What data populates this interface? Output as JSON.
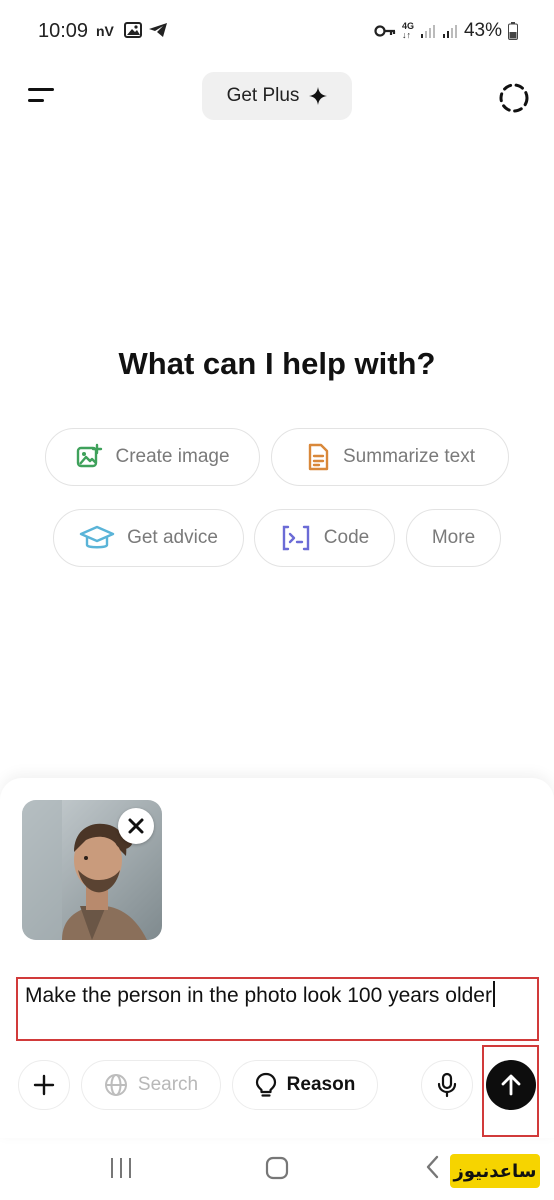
{
  "status": {
    "time": "10:09",
    "network": "4G",
    "battery": "43%"
  },
  "header": {
    "get_plus_label": "Get Plus"
  },
  "main": {
    "headline": "What can I help with?",
    "chips": [
      {
        "label": "Create image",
        "icon": "image-plus-icon",
        "color": "#3fa15b"
      },
      {
        "label": "Summarize text",
        "icon": "document-icon",
        "color": "#d9883a"
      },
      {
        "label": "Get advice",
        "icon": "graduation-cap-icon",
        "color": "#5ab4d8"
      },
      {
        "label": "Code",
        "icon": "code-icon",
        "color": "#6b6bd6"
      },
      {
        "label": "More"
      }
    ]
  },
  "composer": {
    "prompt_text": "Make the person in the photo look 100 years older",
    "tools": {
      "search_label": "Search",
      "reason_label": "Reason"
    }
  },
  "watermark": {
    "text": "ساعدنیوز"
  },
  "colors": {
    "highlight": "#d13a3a",
    "send_button": "#0d0d0d",
    "chip_text": "#7a7a7a"
  }
}
